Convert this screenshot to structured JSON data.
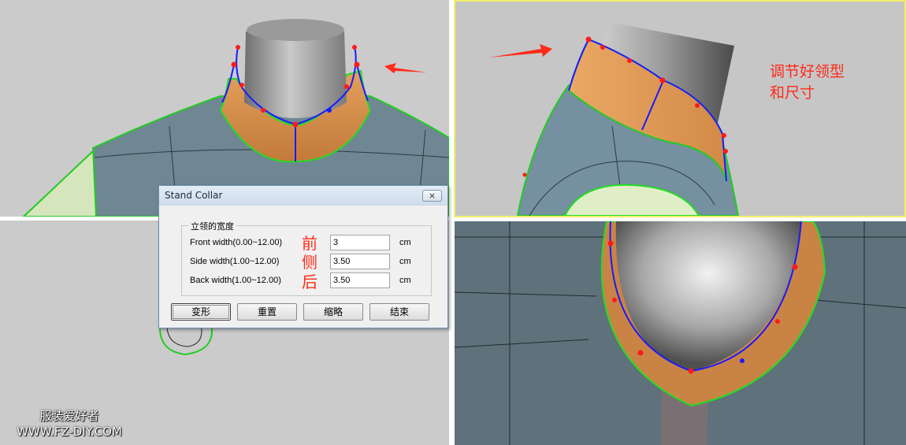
{
  "dialog": {
    "title": "Stand Collar",
    "close_glyph": "⨯",
    "group_label": "立领的宽度",
    "fields": [
      {
        "label": "Front width(0.00~12.00)",
        "value": "3",
        "unit": "cm",
        "annotation": "前"
      },
      {
        "label": "Side width(1.00~12.00)",
        "value": "3.50",
        "unit": "cm",
        "annotation": "侧"
      },
      {
        "label": "Back width(1.00~12.00)",
        "value": "3.50",
        "unit": "cm",
        "annotation": "后"
      }
    ],
    "buttons": [
      {
        "label": "变形"
      },
      {
        "label": "重置"
      },
      {
        "label": "缩略"
      },
      {
        "label": "结束"
      }
    ]
  },
  "annotations": {
    "note_line1": "调节好领型",
    "note_line2": "和尺寸"
  },
  "watermark": {
    "line1": "服装爱好者",
    "line2": "WWW.FZ-DIY.COM"
  },
  "colors": {
    "viewport_bg": "#cbcbcb",
    "body_mesh": "#6f8793",
    "collar_fill": "#d48a4a",
    "curve_blue": "#1a1aff",
    "curve_green": "#22dd22",
    "control_point": "#ff1a1a",
    "annotation_red": "#ff2a1a",
    "active_viewport_border": "#f3f06c"
  }
}
